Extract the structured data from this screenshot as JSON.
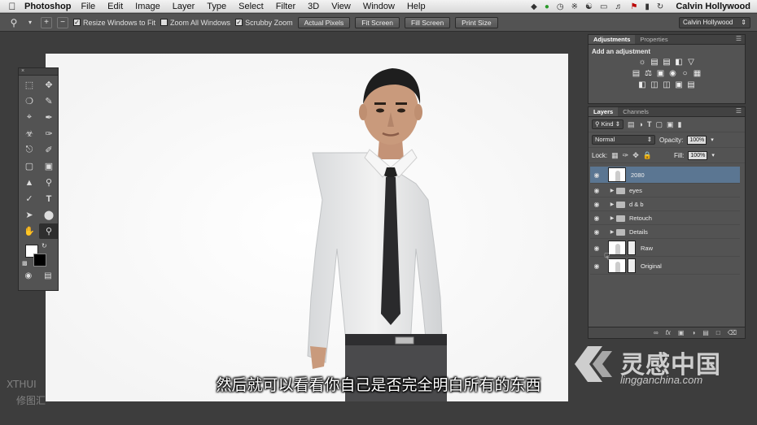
{
  "menubar": {
    "app_name": "Photoshop",
    "menus": [
      "File",
      "Edit",
      "Image",
      "Layer",
      "Type",
      "Select",
      "Filter",
      "3D",
      "View",
      "Window",
      "Help"
    ],
    "user": "Calvin Hollywood",
    "status_icons": [
      "dropbox-icon",
      "evernote-icon",
      "timemachine-icon",
      "bluetooth-icon",
      "wifi-icon",
      "display-icon",
      "volume-icon",
      "flag-icon",
      "battery-icon",
      "sync-icon"
    ]
  },
  "options_bar": {
    "resize_windows_label": "Resize Windows to Fit",
    "resize_windows_checked": true,
    "zoom_all_label": "Zoom All Windows",
    "zoom_all_checked": false,
    "scrubby_label": "Scrubby Zoom",
    "scrubby_checked": true,
    "actual_pixels": "Actual Pixels",
    "fit_screen": "Fit Screen",
    "fill_screen": "Fill Screen",
    "print_size": "Print Size",
    "workspace": "Calvin Hollywood"
  },
  "adjustments": {
    "tab_adjustments": "Adjustments",
    "tab_properties": "Properties",
    "title": "Add an adjustment"
  },
  "layers_panel": {
    "tab_layers": "Layers",
    "tab_channels": "Channels",
    "filter_kind": "Kind",
    "blend_mode": "Normal",
    "opacity_label": "Opacity:",
    "opacity_value": "100%",
    "lock_label": "Lock:",
    "fill_label": "Fill:",
    "fill_value": "100%",
    "layers": [
      {
        "name": "2080",
        "type": "layer",
        "selected": true
      },
      {
        "name": "eyes",
        "type": "group"
      },
      {
        "name": "d & b",
        "type": "group"
      },
      {
        "name": "Retouch",
        "type": "group"
      },
      {
        "name": "Details",
        "type": "group"
      },
      {
        "name": "Raw",
        "type": "layer"
      },
      {
        "name": "Original",
        "type": "layer"
      }
    ]
  },
  "subtitle": "然后就可以看看你自己是否完全明白所有的东西",
  "watermark_left": [
    "XTHUI",
    "修图汇"
  ],
  "watermark_right": {
    "cn": "灵感中国",
    "url": "lingganchina.com"
  },
  "colors": {
    "foreground": "#ffffff",
    "background": "#000000",
    "selected_layer": "#5b7692"
  }
}
